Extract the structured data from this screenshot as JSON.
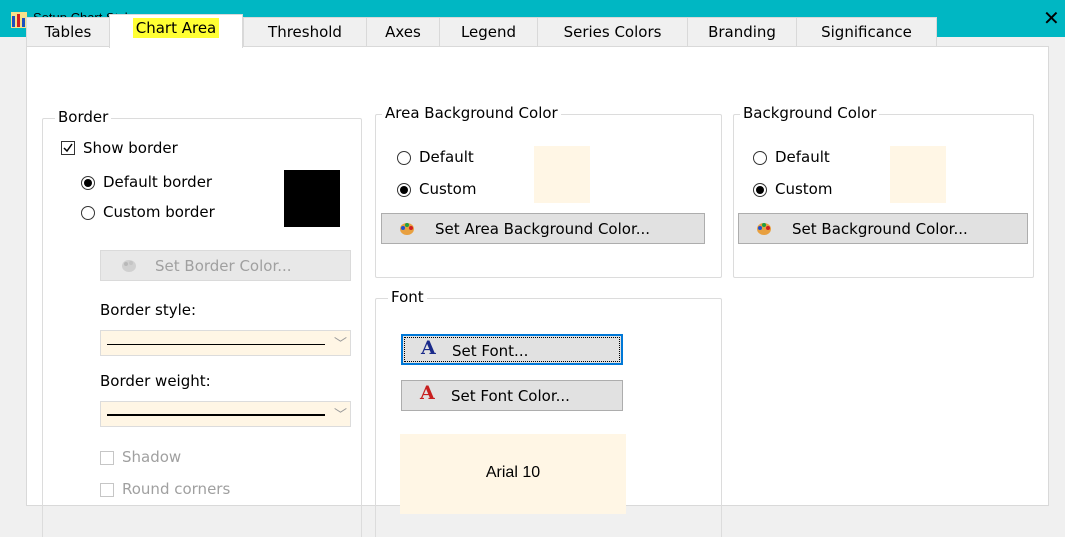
{
  "window": {
    "title": "Setup Chart Style",
    "close_glyph": "✕"
  },
  "tabs": [
    {
      "label": "Tables"
    },
    {
      "label": "Chart Area",
      "active": true
    },
    {
      "label": "Threshold"
    },
    {
      "label": "Axes"
    },
    {
      "label": "Legend"
    },
    {
      "label": "Series Colors"
    },
    {
      "label": "Branding"
    },
    {
      "label": "Significance"
    }
  ],
  "border": {
    "title": "Border",
    "show_border": {
      "label": "Show border",
      "checked": true
    },
    "default_border": {
      "label": "Default border",
      "selected": true
    },
    "custom_border": {
      "label": "Custom border",
      "selected": false
    },
    "color_swatch": "#000000",
    "set_color_button": "Set Border Color...",
    "style_label": "Border style:",
    "weight_label": "Border weight:",
    "shadow": {
      "label": "Shadow",
      "checked": false
    },
    "round_corners": {
      "label": "Round corners",
      "checked": false
    }
  },
  "area_background": {
    "title": "Area Background Color",
    "default_label": "Default",
    "custom_label": "Custom",
    "selected": "Custom",
    "swatch": "#fff6e5",
    "button": "Set Area Background Color..."
  },
  "background": {
    "title": "Background Color",
    "default_label": "Default",
    "custom_label": "Custom",
    "selected": "Custom",
    "swatch": "#fff6e5",
    "button": "Set Background Color..."
  },
  "font": {
    "title": "Font",
    "set_font_button": "Set Font...",
    "set_font_color_button": "Set Font Color...",
    "preview_text": "Arial 10",
    "preview_bg": "#fff6e5"
  },
  "colors": {
    "titlebar": "#00b7c3",
    "active_tab_highlight": "#ffff33"
  }
}
